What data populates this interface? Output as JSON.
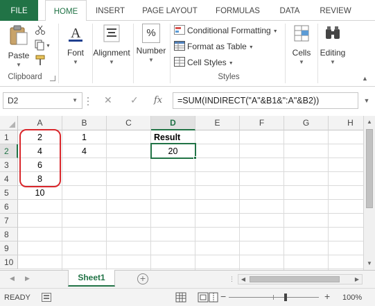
{
  "tabs": [
    "FILE",
    "HOME",
    "INSERT",
    "PAGE LAYOUT",
    "FORMULAS",
    "DATA",
    "REVIEW"
  ],
  "ribbon": {
    "clipboard": {
      "paste": "Paste",
      "group_label": "Clipboard"
    },
    "font": {
      "label": "Font"
    },
    "alignment": {
      "label": "Alignment"
    },
    "number": {
      "label": "Number",
      "symbol": "%"
    },
    "styles": {
      "conditional_formatting": "Conditional Formatting",
      "format_as_table": "Format as Table",
      "cell_styles": "Cell Styles",
      "group_label": "Styles"
    },
    "cells": {
      "label": "Cells"
    },
    "editing": {
      "label": "Editing"
    },
    "accent_color": "#217346"
  },
  "formula_bar": {
    "name_box": "D2",
    "cancel": "✕",
    "enter": "✓",
    "fx": "fx",
    "formula": "=SUM(INDIRECT(\"A\"&B1&\":A\"&B2))"
  },
  "grid": {
    "columns": [
      "A",
      "B",
      "C",
      "D",
      "E",
      "F",
      "G",
      "H"
    ],
    "selected_column": "D",
    "rows": [
      "1",
      "2",
      "3",
      "4",
      "5",
      "6",
      "7",
      "8",
      "9",
      "10"
    ],
    "selected_row": "2",
    "cells": {
      "A1": "2",
      "A2": "4",
      "A3": "6",
      "A4": "8",
      "A5": "10",
      "B1": "1",
      "B2": "4",
      "D1": "Result",
      "D2": "20"
    },
    "annotation_color": "#d9262b"
  },
  "sheets": {
    "active": "Sheet1",
    "add": "+"
  },
  "status": {
    "ready": "READY",
    "zoom": "100%",
    "zoom_percent": 100
  }
}
